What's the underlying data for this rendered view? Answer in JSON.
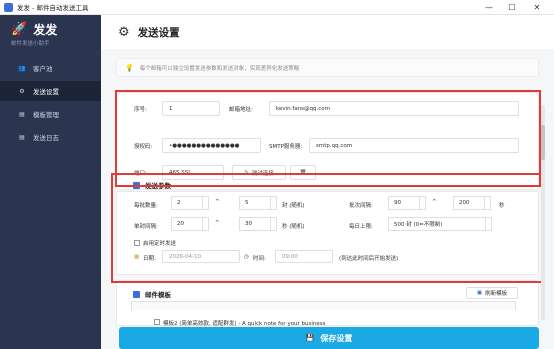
{
  "window": {
    "title": "发发 - 邮件自动发送工具",
    "minimize": "—",
    "maximize": "☐",
    "close": "✕"
  },
  "sidebar": {
    "brand_icon": "🚀",
    "brand_name": "发发",
    "brand_sub": "邮件发送小助手",
    "items": [
      {
        "icon": "👥",
        "label": "客户池"
      },
      {
        "icon": "⚙",
        "label": "发送设置"
      },
      {
        "icon": "▤",
        "label": "模板管理"
      },
      {
        "icon": "▤",
        "label": "发送日志"
      }
    ]
  },
  "header": {
    "icon": "⚙",
    "title": "发送设置"
  },
  "tip": {
    "icon": "💡",
    "text": "每个邮箱可以独立设置发送参数和发送对象，实现差异化发送策略"
  },
  "account": {
    "seq_label": "序号:",
    "seq_value": "1",
    "email_label": "邮箱地址:",
    "email_value": "kevin.fans@qq.com",
    "auth_label": "授权码:",
    "auth_value": "•●●●●●●●●●●●●●●",
    "smtp_label": "SMTP服务器:",
    "smtp_value": "smtp.qq.com",
    "port_label": "端口:",
    "port_value": "465 SSL",
    "test_button": "测试连接",
    "test_icon": "✎",
    "delete_icon": "🗑"
  },
  "params": {
    "title": "发送参数",
    "per_count_label": "每批数量:",
    "per_count_min": "2",
    "per_count_caret": "^",
    "per_count_max": "5",
    "per_count_unit": "封 (随机)",
    "batch_interval_label": "批次间隔:",
    "batch_interval_min": "90",
    "batch_interval_caret": "^",
    "batch_interval_max": "200",
    "batch_interval_unit": "秒",
    "single_interval_label": "单封间隔:",
    "single_interval_min": "20",
    "single_interval_caret": "^",
    "single_interval_max": "30",
    "single_interval_unit": "秒 (随机)",
    "daily_limit_label": "每日上限:",
    "daily_limit_value": "500 封 (0=不限制)",
    "schedule_label": "启用定时发送",
    "date_label": "日期:",
    "date_value": "2026-04-10",
    "time_label": "时间:",
    "time_value": "09:00",
    "schedule_hint": "(到达此时间后开始发送)"
  },
  "templates": {
    "title": "邮件模板",
    "refresh_button": "刷新模板",
    "item_label": "模板2 (简单高效款, 适配群发) - A quick note for your business"
  },
  "save_button": {
    "icon": "💾",
    "label": "保存设置"
  }
}
